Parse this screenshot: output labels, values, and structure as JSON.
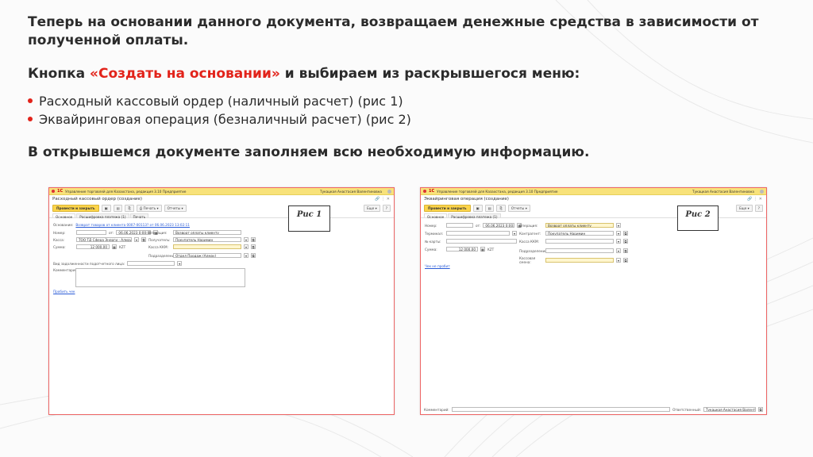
{
  "slide": {
    "heading1": "Теперь на основании данного документа, возвращаем денежные средства в зависимости от полученной оплаты.",
    "heading2_prefix": "Кнопка ",
    "heading2_accent": "«Создать на основании»",
    "heading2_suffix": " и выбираем из раскрывшегося меню:",
    "bullets": [
      "Расходный кассовый ордер (наличный расчет) (рис 1)",
      "Эквайринговая операция (безналичный расчет) (рис 2)"
    ],
    "heading3": "В открывшемся документе заполняем всю необходимую информацию."
  },
  "colors": {
    "accent": "#e2231a",
    "titlebar": "#f8e27a",
    "main_button": "#fcd44a"
  },
  "win1": {
    "app_title": "Управление торговлей для Казахстана, редакция 3.10 Предприятие",
    "logo": "1С",
    "user": "Тукацкая Анастасия Валентиновна",
    "doc_title": "Расходный кассовый ордер (создание)",
    "post_close": "Провести и закрыть",
    "print": "Печать",
    "reports": "Отчеты",
    "more": "Еще",
    "help": "?",
    "tabs": [
      "Основное",
      "Расшифровка платежа (1)",
      "Печать"
    ],
    "basis_label": "Основание:",
    "basis_link": "Возврат товаров от клиента 0007-00113? от 06.06.2023 13:02:11",
    "number_label": "Номер:",
    "from_label": "от:",
    "date_value": "06.06.2023  0:00:00",
    "operation_label": "Операция:",
    "operation_value": "Возврат оплаты клиенту",
    "cash_label": "Касса:",
    "cash_value": "ТОО ТД Сфера Энерги - Алмау",
    "recipient_label": "Получатель:",
    "recipient_value": "Покупатель Наримин",
    "sum_label": "Сумма:",
    "sum_value": "12 000,00",
    "currency": "KZT",
    "kkm_label": "Касса ККМ:",
    "dept_label": "Подразделение:",
    "dept_value": "Отдел Продаж (Алмау)",
    "debt_label": "Вид задолженности подотчетного лица:",
    "comment_label": "Комментарий:",
    "bottom_link": "Пробить чек",
    "callout": "Рис 1"
  },
  "win2": {
    "app_title": "Управление торговлей для Казахстана, редакция 3.10 Предприятие",
    "logo": "1С",
    "user": "Тукацкая Анастасия Валентиновна",
    "doc_title": "Эквайринговая операция (создание)",
    "post_close": "Провести и закрыть",
    "reports": "Отчеты",
    "more": "Еще",
    "help": "?",
    "tabs": [
      "Основное",
      "Расшифровка платежа (1)"
    ],
    "number_label": "Номер:",
    "from_label": "от:",
    "date_value": "06.06.2023  0:00:00",
    "operation_label": "Операция:",
    "operation_value": "Возврат оплаты клиенту",
    "terminal_label": "Терминал:",
    "counterparty_label": "Контрагент:",
    "counterparty_value": "Покупатель Наримин",
    "card_label": "№ карты:",
    "kkm_label": "Касса ККМ:",
    "sum_label": "Сумма:",
    "sum_value": "12 000,00",
    "currency": "KZT",
    "dept_label": "Подразделение:",
    "shift_label": "Кассовая смена:",
    "bottom_link": "Чек не пробит",
    "comment_label": "Комментарий:",
    "responsible_label": "Ответственный:",
    "responsible_value": "Тукацкая Анастасия Валентиновна",
    "callout": "Рис 2"
  }
}
